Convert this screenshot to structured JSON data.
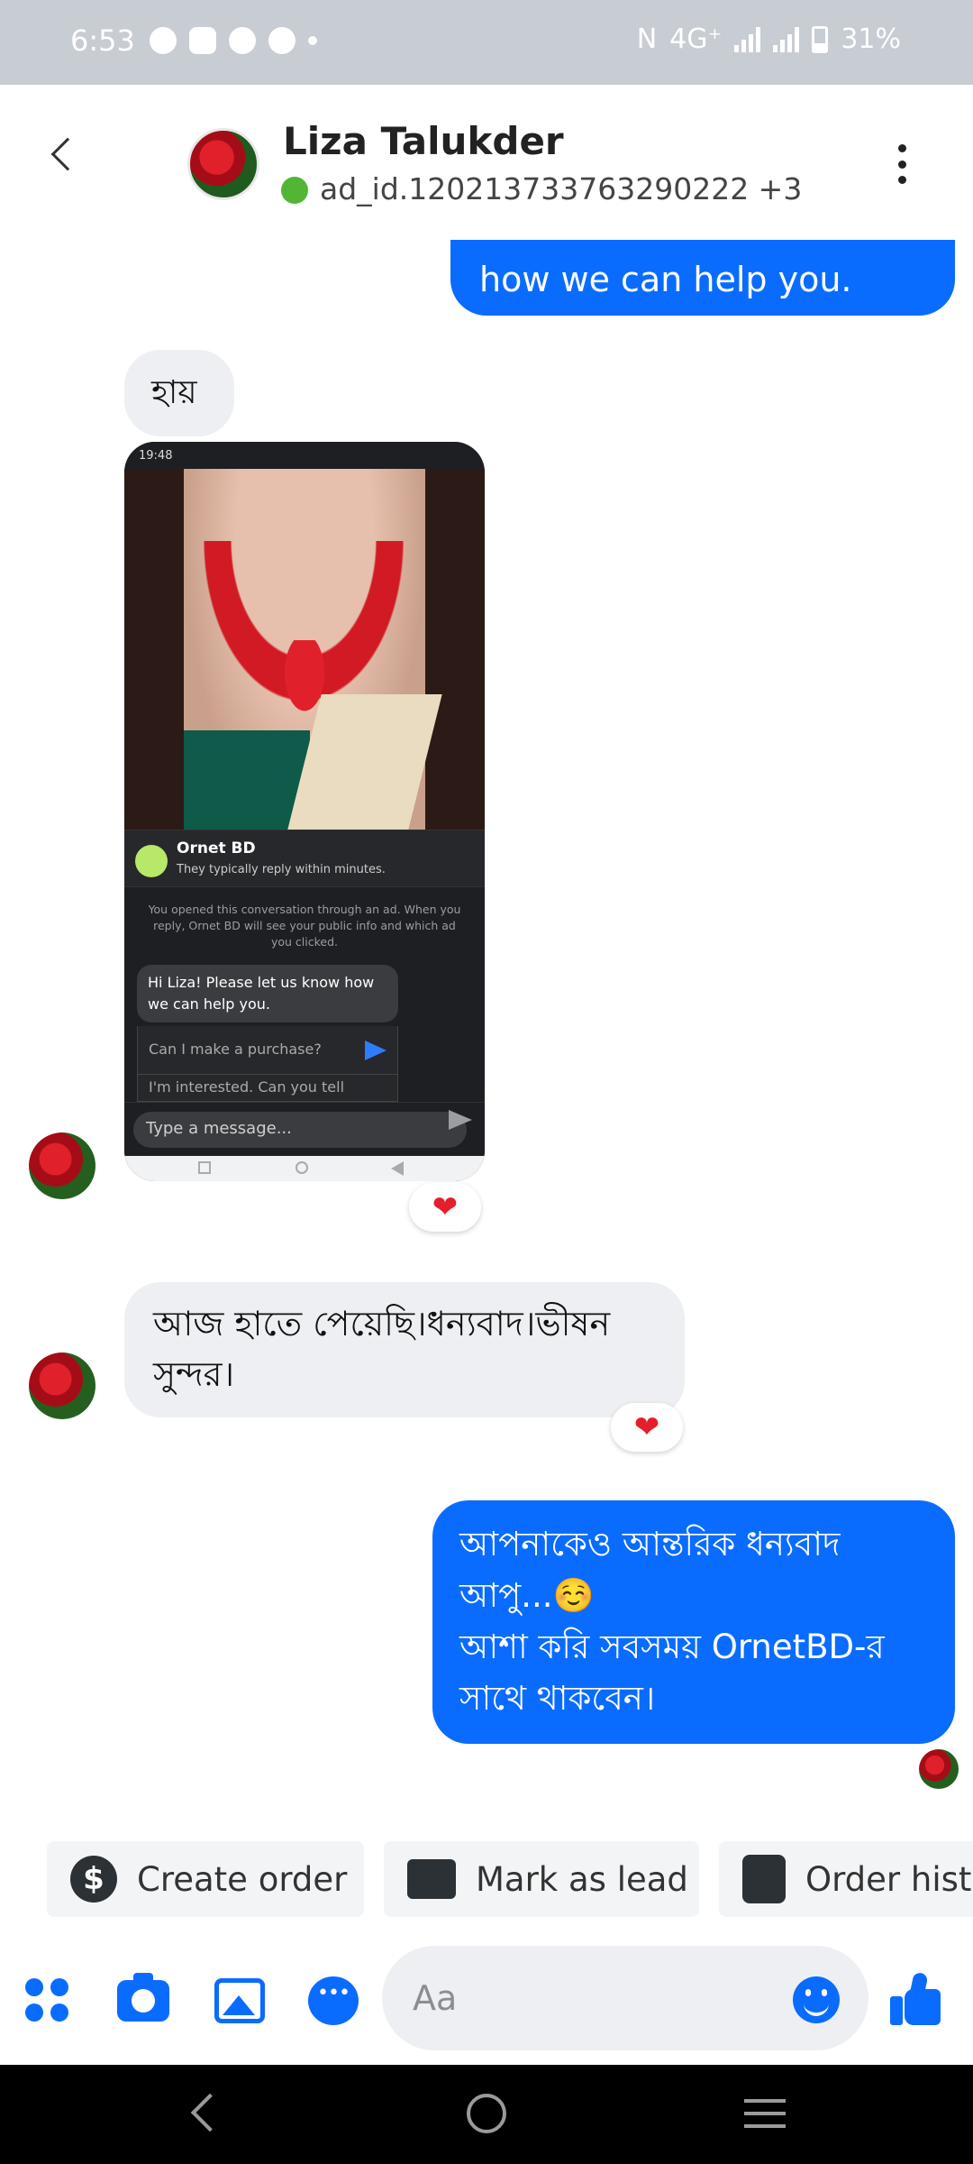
{
  "status_bar": {
    "time": "6:53",
    "network": "4G⁺",
    "battery": "31%"
  },
  "header": {
    "contact_name": "Liza Talukder",
    "subtitle": "ad_id.120213733763290222 +3"
  },
  "messages": {
    "top_out_partial": "Hi Liza! Please let us know how we can help you.",
    "top_out_visible": "how we can help you.",
    "hi": "হায়",
    "received_text_line1": "আজ হাতে পেয়েছি।ধন্যবাদ।ভীষন",
    "received_text_line2": "সুন্দর।",
    "reply_line1": "আপনাকেও আন্তরিক ধন্যবাদ",
    "reply_line2": "আপু...☺️",
    "reply_line3": "আশা করি সবসময় OrnetBD-র",
    "reply_line4": "সাথে থাকবেন।",
    "reaction": "❤"
  },
  "embedded_screenshot": {
    "status_time": "19:48",
    "page_name": "Ornet BD",
    "page_reply_time": "They typically reply within minutes.",
    "ad_notice": "You opened this conversation through an ad. When you reply, Ornet BD will see your public info and which ad you clicked.",
    "greeting": "Hi Liza! Please let us know how we can help you.",
    "quick_reply_1": "Can I make a purchase?",
    "quick_reply_2": "I'm interested. Can you tell",
    "input_placeholder": "Type a message..."
  },
  "quick_actions": [
    {
      "label": "Create order",
      "icon": "dollar-icon"
    },
    {
      "label": "Mark as lead",
      "icon": "id-card-icon"
    },
    {
      "label": "Order hist",
      "icon": "list-icon"
    }
  ],
  "composer": {
    "placeholder": "Aa"
  },
  "colors": {
    "accent": "#0a6cff",
    "incoming_bubble": "#eeeff2",
    "online": "#53b535",
    "heart": "#e41e2a"
  }
}
